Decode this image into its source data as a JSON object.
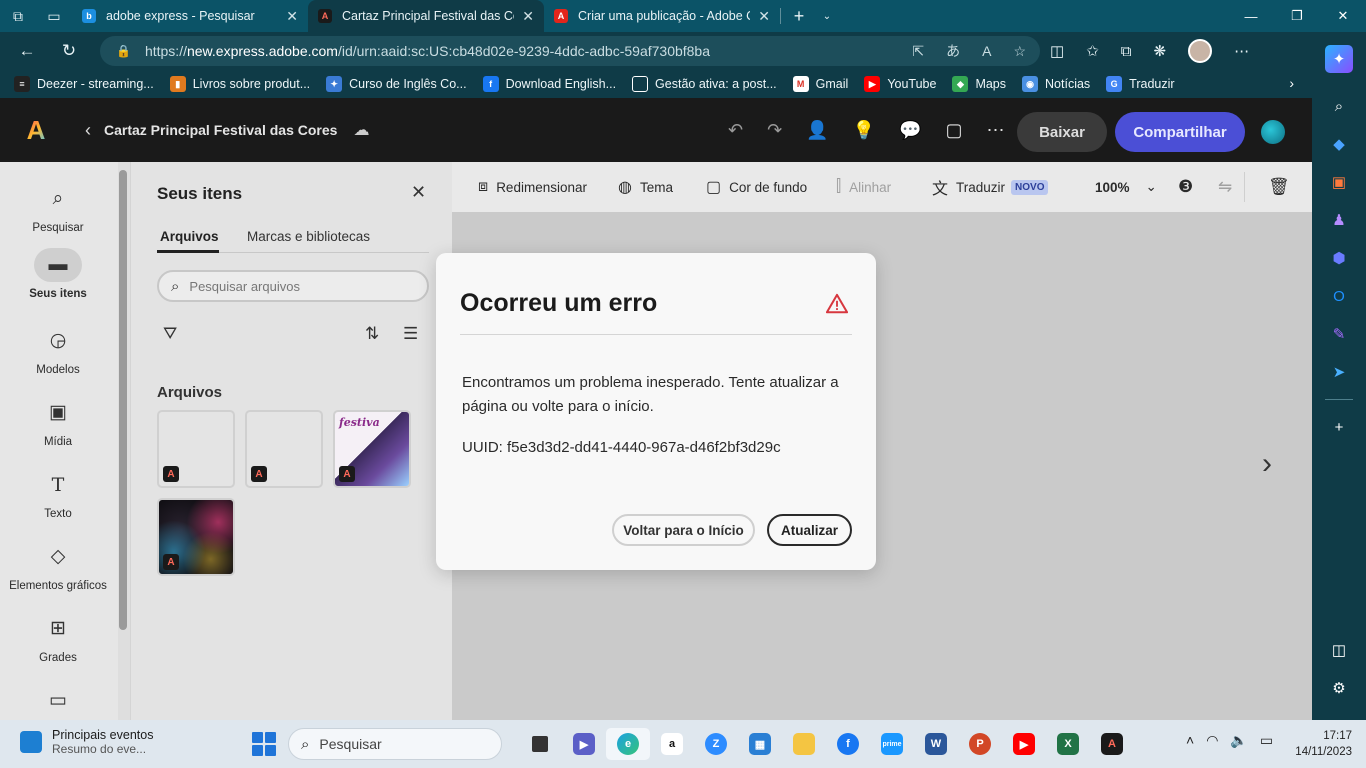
{
  "browser": {
    "tabs": [
      {
        "label": "adobe express - Pesquisar",
        "active": false
      },
      {
        "label": "Cartaz Principal Festival das Cores",
        "active": true
      },
      {
        "label": "Criar uma publicação - Adobe Cr",
        "active": false
      }
    ],
    "url_prefix": "https://",
    "url_host": "new.express.adobe.com",
    "url_path": "/id/urn:aaid:sc:US:cb48d02e-9239-4ddc-adbc-59af730bf8ba",
    "bookmarks": [
      {
        "label": "Deezer - streaming...",
        "color": "#222222"
      },
      {
        "label": "Livros sobre produt...",
        "color": "#e07a1f"
      },
      {
        "label": "Curso de Inglês Co...",
        "color": "#3a7bd5"
      },
      {
        "label": "Download English...",
        "color": "#1877f2"
      },
      {
        "label": "Gestão ativa: a post...",
        "color": "#ffffff"
      },
      {
        "label": "Gmail",
        "color": "#d93025"
      },
      {
        "label": "YouTube",
        "color": "#ff0000"
      },
      {
        "label": "Maps",
        "color": "#34a853"
      },
      {
        "label": "Notícias",
        "color": "#4a90e2"
      },
      {
        "label": "Traduzir",
        "color": "#4285f4"
      }
    ]
  },
  "app": {
    "doc_title": "Cartaz Principal Festival das Cores",
    "download_label": "Baixar",
    "share_label": "Compartilhar",
    "accent": "#4b4fd6"
  },
  "rail": [
    {
      "label": "Pesquisar",
      "icon": "search-icon",
      "active": false
    },
    {
      "label": "Seus itens",
      "icon": "folder-icon",
      "active": true
    },
    {
      "label": "Modelos",
      "icon": "templates-icon",
      "active": false
    },
    {
      "label": "Mídia",
      "icon": "media-icon",
      "active": false
    },
    {
      "label": "Texto",
      "icon": "text-icon",
      "active": false
    },
    {
      "label": "Elementos gráficos",
      "icon": "shapes-icon",
      "active": false
    },
    {
      "label": "Grades",
      "icon": "grid-icon",
      "active": false
    }
  ],
  "panel": {
    "title": "Seus itens",
    "tab_files": "Arquivos",
    "tab_brands": "Marcas e bibliotecas",
    "search_placeholder": "Pesquisar arquivos",
    "section": "Arquivos",
    "thumb3_text": "festiva"
  },
  "toolbar": {
    "resize": "Redimensionar",
    "theme": "Tema",
    "bg_color": "Cor de fundo",
    "align": "Alinhar",
    "translate": "Traduzir",
    "new_badge": "NOVO",
    "zoom": "100%"
  },
  "modal": {
    "title": "Ocorreu um erro",
    "message": "Encontramos um problema inesperado. Tente atualizar a página ou volte para o início.",
    "uuid": "UUID: f5e3d3d2-dd41-4440-967a-d46f2bf3d29c",
    "back_label": "Voltar para o Início",
    "refresh_label": "Atualizar"
  },
  "taskbar": {
    "widget_title": "Principais eventos",
    "widget_sub": "Resumo do eve...",
    "search_placeholder": "Pesquisar",
    "time": "17:17",
    "date": "14/11/2023"
  }
}
